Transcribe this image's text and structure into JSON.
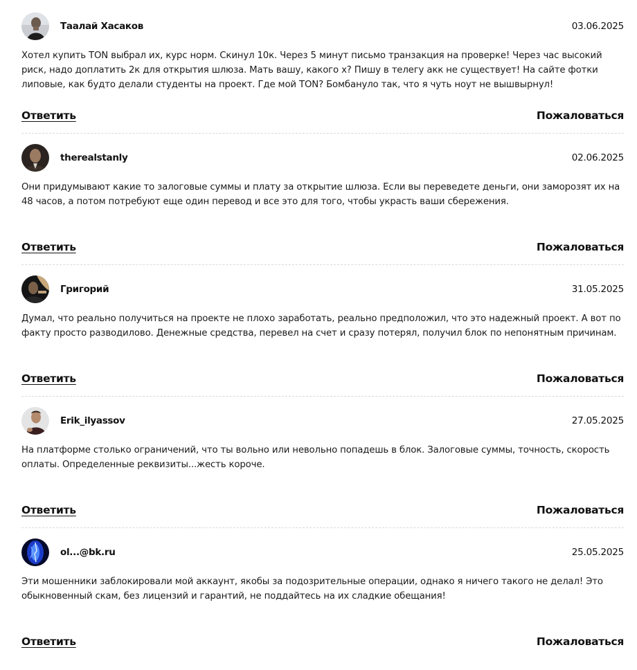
{
  "comments": [
    {
      "author": "Таалай Хасаков",
      "date": "03.06.2025",
      "text": "Хотел купить TON выбрал их, курс норм. Скинул 10к. Через 5 минут письмо транзакция на проверке! Через час высокий риск, надо доплатить 2к для открытия шлюза. Мать вашу, какого х? Пишу в телегу акк не существует! На сайте фотки липовые, как будто делали студенты на проект. Где мой TON? Бомбануло так, что я чуть ноут не вышвырнул!",
      "reply_label": "Ответить",
      "report_label": "Пожаловаться"
    },
    {
      "author": "therealstanly",
      "date": "02.06.2025",
      "text": "Они придумывают какие то залоговые суммы и плату за открытие шлюза. Если вы переведете деньги, они заморозят их на 48 часов, а потом потребуют еще один перевод и все это для того, чтобы украсть ваши сбережения.",
      "reply_label": "Ответить",
      "report_label": "Пожаловаться"
    },
    {
      "author": "Григорий",
      "date": "31.05.2025",
      "text": "Думал, что реально получиться на проекте не плохо заработать, реально предположил, что это надежный проект. А вот по факту просто разводилово. Денежные средства, перевел на счет и сразу потерял, получил блок по непонятным причинам.",
      "reply_label": "Ответить",
      "report_label": "Пожаловаться"
    },
    {
      "author": "Erik_ilyassov",
      "date": "27.05.2025",
      "text": "На платформе столько ограничений, что ты вольно или невольно попадешь в блок. Залоговые суммы, точность, скорость оплаты. Определенные реквизиты...жесть короче.",
      "reply_label": "Ответить",
      "report_label": "Пожаловаться"
    },
    {
      "author": "ol...@bk.ru",
      "date": "25.05.2025",
      "text": "Эти мошенники заблокировали мой аккаунт, якобы за подозрительные операции, однако я ничего такого не делал! Это обыкновенный скам, без лицензий и гарантий, не поддайтесь на их сладкие обещания!",
      "reply_label": "Ответить",
      "report_label": "Пожаловаться"
    }
  ]
}
